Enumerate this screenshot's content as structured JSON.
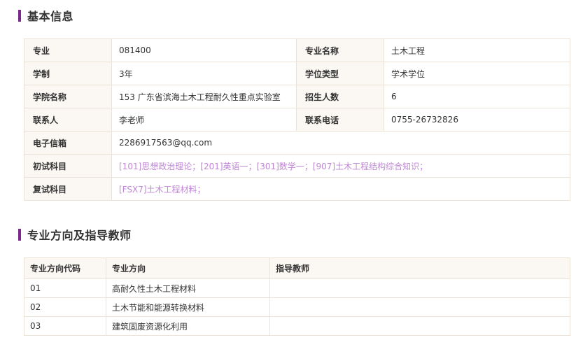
{
  "section1": {
    "title": "基本信息"
  },
  "info": {
    "major_label": "专业",
    "major_code": "081400",
    "major_name_label": "专业名称",
    "major_name": "土木工程",
    "duration_label": "学制",
    "duration": "3年",
    "degree_type_label": "学位类型",
    "degree_type": "学术学位",
    "college_label": "学院名称",
    "college": "153 广东省滨海土木工程耐久性重点实验室",
    "enroll_label": "招生人数",
    "enroll": "6",
    "contact_label": "联系人",
    "contact": "李老师",
    "phone_label": "联系电话",
    "phone": "0755-26732826",
    "email_label": "电子信箱",
    "email": "2286917563@qq.com",
    "prelim_label": "初试科目",
    "prelim": "[101]思想政治理论；[201]英语一；[301]数学一；[907]土木工程结构综合知识；",
    "retest_label": "复试科目",
    "retest": "[FSX7]土木工程材料；"
  },
  "section2": {
    "title": "专业方向及指导教师"
  },
  "directions": {
    "headers": [
      "专业方向代码",
      "专业方向",
      "指导教师"
    ],
    "rows": [
      {
        "code": "01",
        "name": "高耐久性土木工程材料",
        "advisor": ""
      },
      {
        "code": "02",
        "name": "土木节能和能源转换材料",
        "advisor": ""
      },
      {
        "code": "03",
        "name": "建筑固废资源化利用",
        "advisor": ""
      }
    ]
  }
}
